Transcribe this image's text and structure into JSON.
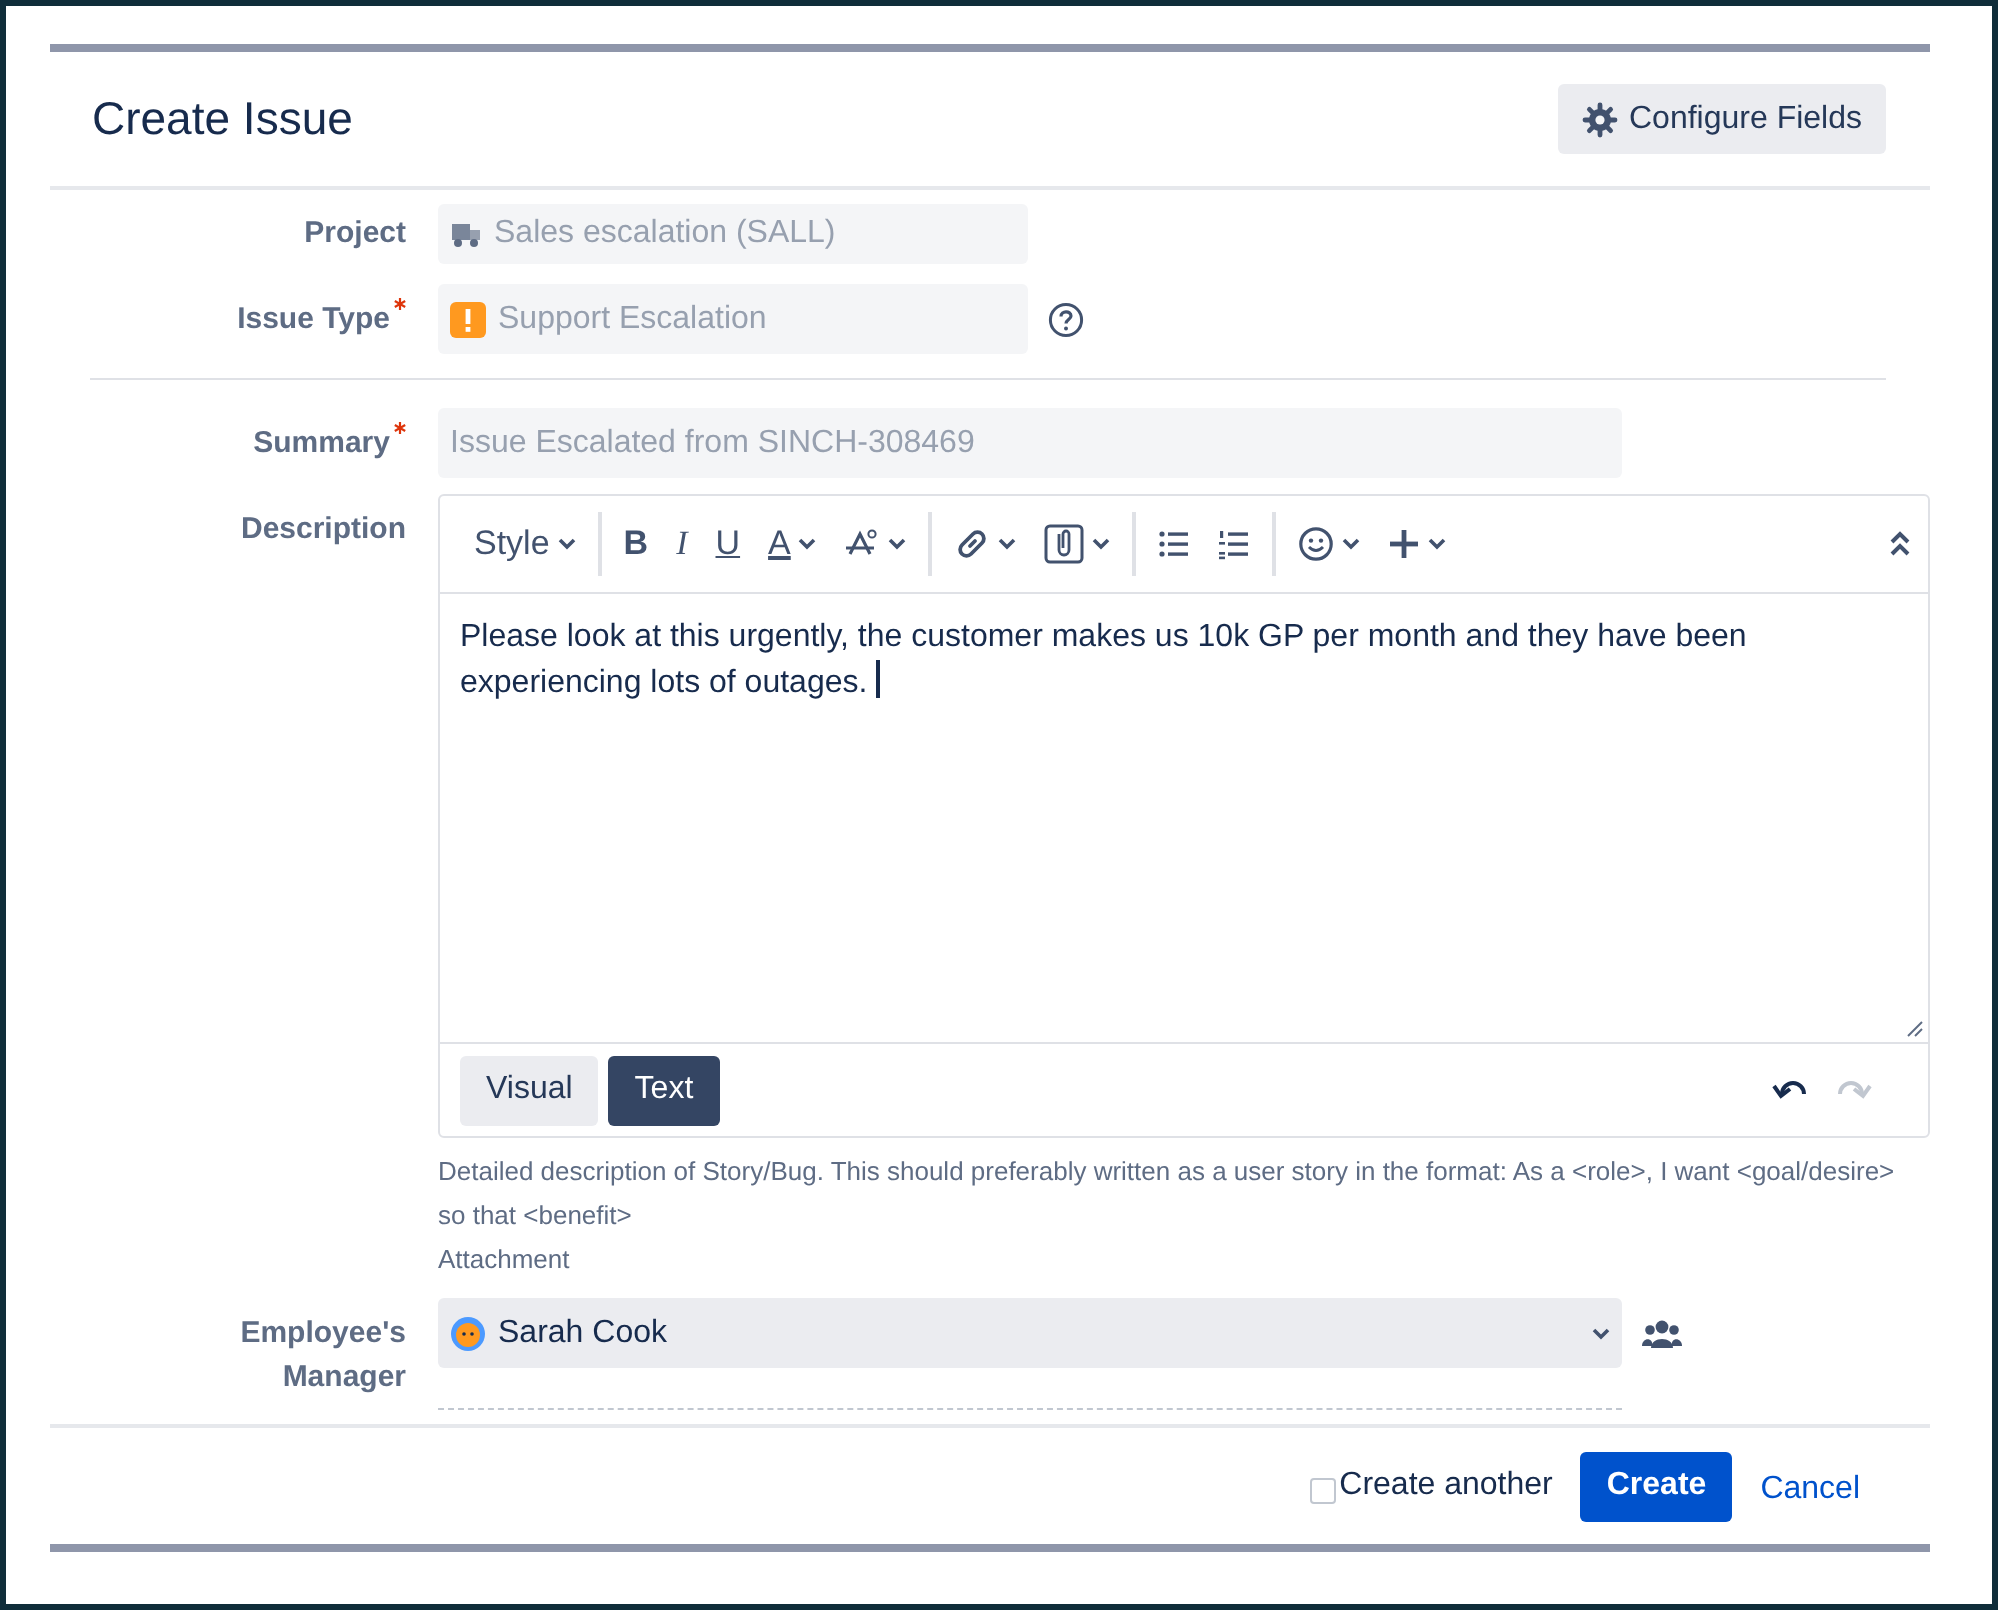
{
  "dialog": {
    "title": "Create Issue",
    "configure_button": "Configure Fields"
  },
  "fields": [
    {
      "kind": "project",
      "label": "Project",
      "required": false,
      "value": "Sales escalation (SALL)",
      "disabled": true
    },
    {
      "kind": "issue-type",
      "label": "Issue Type",
      "required": true,
      "value": "Support Escalation",
      "disabled": true
    },
    {
      "kind": "summary",
      "label": "Summary",
      "required": true,
      "value": "Issue Escalated from SINCH-308469",
      "disabled": true
    },
    {
      "kind": "description",
      "label": "Description",
      "required": false
    },
    {
      "kind": "user-picker",
      "label": "Employee's Manager",
      "required": false,
      "value": "Sarah Cook",
      "disabled": false
    }
  ],
  "editor": {
    "toolbar": [
      [
        {
          "kind": "style-menu",
          "label": "Style",
          "dropdown": true
        }
      ],
      [
        {
          "kind": "bold",
          "label": "B",
          "dropdown": false
        },
        {
          "kind": "italic",
          "label": "I",
          "dropdown": false
        },
        {
          "kind": "underline",
          "label": "U",
          "dropdown": false
        },
        {
          "kind": "text-color",
          "label": "A",
          "dropdown": true
        },
        {
          "kind": "more-formatting",
          "dropdown": true
        }
      ],
      [
        {
          "kind": "link",
          "dropdown": true
        },
        {
          "kind": "attachment",
          "dropdown": true
        }
      ],
      [
        {
          "kind": "bullet-list",
          "dropdown": false
        },
        {
          "kind": "numbered-list",
          "dropdown": false
        }
      ],
      [
        {
          "kind": "emoji",
          "dropdown": true
        },
        {
          "kind": "insert",
          "dropdown": true
        }
      ]
    ],
    "body": "Please look at this urgently, the customer makes us 10k GP per month and they have been experiencing lots of outages.",
    "modes": [
      {
        "label": "Visual",
        "selected": false
      },
      {
        "label": "Text",
        "selected": true
      }
    ],
    "redo_disabled": true,
    "help": "Detailed description of Story/Bug. This should preferably written as a user story in the format: As a <role>, I want <goal/desire> so that <benefit>",
    "attachment_label": "Attachment"
  },
  "footer": {
    "create_another": {
      "label": "Create another",
      "checked": false
    },
    "create_button": "Create",
    "cancel_link": "Cancel"
  }
}
